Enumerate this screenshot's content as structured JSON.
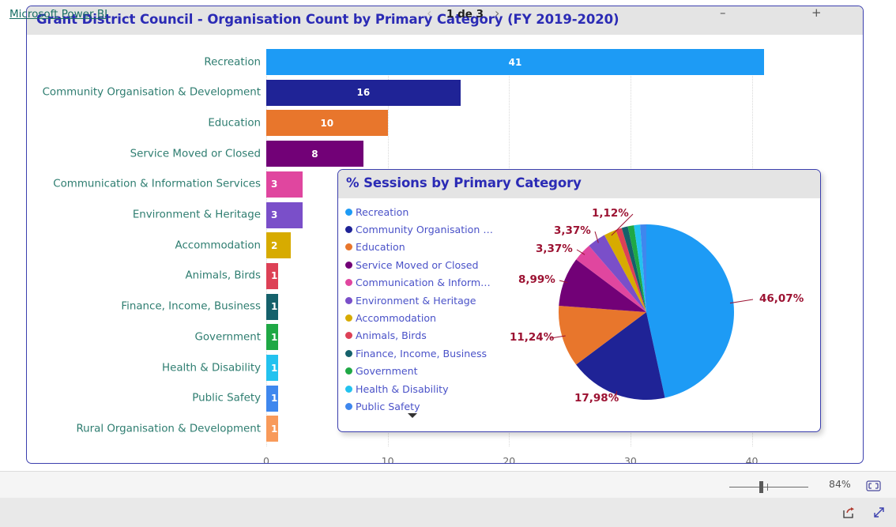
{
  "bar_visual": {
    "title": "Grant District Council - Organisation Count by Primary Category (FY 2019-2020)"
  },
  "pie_visual": {
    "title": "% Sessions by Primary Category",
    "legend_more_icon": "chevron-down-icon"
  },
  "zoom_bar": {
    "minus_label": "–",
    "plus_label": "+",
    "percent": "84%",
    "fit_icon": "fit-to-page-icon"
  },
  "footer": {
    "powerbi_label": "Microsoft Power BI",
    "prev_label": "‹",
    "next_label": "›",
    "page_indicator": "1 de 3",
    "share_icon": "share-icon",
    "fullscreen_icon": "fullscreen-icon"
  },
  "chart_data": [
    {
      "type": "bar",
      "title": "Grant District Council - Organisation Count by Primary Category (FY 2019-2020)",
      "orientation": "horizontal",
      "xlabel": "",
      "ylabel": "",
      "xlim": [
        0,
        44
      ],
      "xticks": [
        "0",
        "10",
        "20",
        "30",
        "40"
      ],
      "xtick_values": [
        0,
        10,
        20,
        30,
        40
      ],
      "grid": true,
      "categories": [
        "Recreation",
        "Community Organisation & Development",
        "Education",
        "Service Moved or Closed",
        "Communication & Information Services",
        "Environment & Heritage",
        "Accommodation",
        "Animals, Birds",
        "Finance, Income, Business",
        "Government",
        "Health & Disability",
        "Public Safety",
        "Rural Organisation & Development"
      ],
      "values": [
        41,
        16,
        10,
        8,
        3,
        3,
        2,
        1,
        1,
        1,
        1,
        1,
        1
      ],
      "colors": [
        "#1d9bf5",
        "#1f2396",
        "#e8762c",
        "#720177",
        "#e0469f",
        "#7a4fc9",
        "#d7ab00",
        "#dd4156",
        "#15616b",
        "#1fa845",
        "#23c2ef",
        "#3f87ee",
        "#f89a5a"
      ]
    },
    {
      "type": "pie",
      "title": "% Sessions by Primary Category",
      "legend_position": "left",
      "labels": [
        "Recreation",
        "Community Organisation &...",
        "Education",
        "Service Moved or Closed",
        "Communication & Informat...",
        "Environment & Heritage",
        "Accommodation",
        "Animals, Birds",
        "Finance, Income, Business",
        "Government",
        "Health & Disability",
        "Public Safety"
      ],
      "values": [
        46.07,
        17.98,
        11.24,
        8.99,
        3.37,
        3.37,
        2.25,
        1.12,
        1.12,
        1.12,
        1.12,
        1.12
      ],
      "value_labels_shown": [
        "46,07%",
        "17,98%",
        "11,24%",
        "8,99%",
        "3,37%",
        "3,37%",
        "1,12%"
      ],
      "colors": [
        "#1d9bf5",
        "#1f2396",
        "#e8762c",
        "#720177",
        "#e0469f",
        "#7a4fc9",
        "#d7ab00",
        "#dd4156",
        "#15616b",
        "#1fa845",
        "#23c2ef",
        "#3f87ee",
        "#f89a5a"
      ]
    }
  ]
}
